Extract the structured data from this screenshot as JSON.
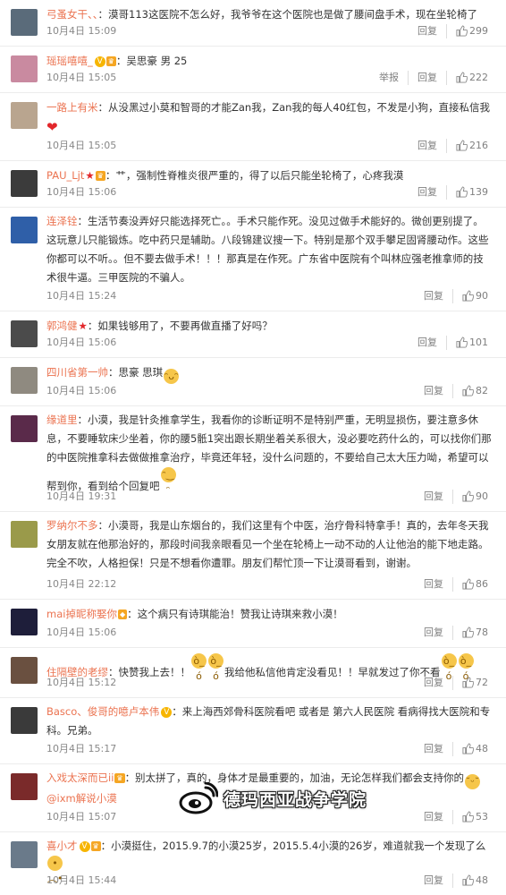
{
  "actions": {
    "report": "举报",
    "reply": "回复"
  },
  "comments": [
    {
      "user": "弓蚤女干、、",
      "text": "：漠哥113这医院不怎么好，我爷爷在这个医院也是做了腰间盘手术，现在坐轮椅了",
      "time": "10月4日 15:09",
      "likes": "299",
      "avatar_color": "#5a6b7a"
    },
    {
      "user": "瑶瑶嘻嘻_",
      "text": "：吴思豪 男 25",
      "time": "10月4日 15:05",
      "likes": "222",
      "avatar_color": "#c98aa0",
      "report": true
    },
    {
      "user": "一路上有米",
      "text": "：从没黑过小莫和智哥的才能Zan我，Zan我的每人40红包，不发是小狗，直接私信我",
      "time": "10月4日 15:05",
      "likes": "216",
      "avatar_color": "#b9a58f"
    },
    {
      "user": "PAU_Ljt",
      "text": "：艹，强制性脊椎炎很严重的，得了以后只能坐轮椅了，心疼我漠",
      "time": "10月4日 15:06",
      "likes": "139",
      "avatar_color": "#3b3b3b"
    },
    {
      "user": "连泽铨",
      "text": "：生活节奏没弄好只能选择死亡。。手术只能作死。没见过做手术能好的。微创更别提了。这玩意儿只能锻炼。吃中药只是辅助。八段锦建议搜一下。特别是那个双手攀足固肾腰动作。这些你都可以不听。。但不要去做手术！！！那真是在作死。广东省中医院有个叫林应强老推拿师的技术很牛逼。三甲医院的不骗人。",
      "time": "10月4日 15:24",
      "likes": "90",
      "avatar_color": "#2f5fa8"
    },
    {
      "user": "郭鸿健",
      "text": "：如果钱够用了，不要再做直播了好吗？",
      "time": "10月4日 15:06",
      "likes": "101",
      "avatar_color": "#4b4b4b"
    },
    {
      "user": "四川省第一帅",
      "text": "：思豪 思琪",
      "time": "10月4日 15:06",
      "likes": "82",
      "avatar_color": "#8f8a80"
    },
    {
      "user": "缘道里",
      "text": "：小漠，我是针灸推拿学生，我看你的诊断证明不是特别严重，无明显损伤，要注意多休息，不要睡软床少坐着，你的腰5骶1突出跟长期坐着关系很大，没必要吃药什么的，可以找你们那的中医院推拿科去做做推拿治疗，毕竟还年轻，没什么问题的，不要给自己太大压力呦，希望可以帮到你，看到给个回复吧",
      "time": "10月4日 19:31",
      "likes": "90",
      "avatar_color": "#5a2a4a"
    },
    {
      "user": "罗纳尔不多",
      "text": "：小漠哥，我是山东烟台的，我们这里有个中医，治疗骨科特拿手！真的，去年冬天我女朋友就在他那治好的，那段时间我亲眼看见一个坐在轮椅上一动不动的人让他治的能下地走路。完全不吹，人格担保！只是不想看你遭罪。朋友们帮忙顶一下让漠哥看到，谢谢。",
      "time": "10月4日 22:12",
      "likes": "86",
      "avatar_color": "#9a9a4a"
    },
    {
      "user": "mai掉昵称娶你",
      "text": "：这个病只有诗琪能治！赞我让诗琪来救小漠！",
      "time": "10月4日 15:06",
      "likes": "78",
      "avatar_color": "#1e1e3a"
    },
    {
      "user": "住隔壁的老缪",
      "text": "：快赞我上去！！",
      "text2": "我给他私信他肯定没看见！！早就发过了你不看",
      "time": "10月4日 15:12",
      "likes": "72",
      "avatar_color": "#6a5040"
    },
    {
      "user": "Basco、俊哥的噫卢本伟",
      "text": "：来上海西郊骨科医院看吧 或者是 第六人民医院 看病得找大医院和专科。兄弟。",
      "time": "10月4日 15:17",
      "likes": "48",
      "avatar_color": "#3a3a3a"
    },
    {
      "user": "入戏太深而已ii",
      "text": "：别太拼了，真的，身体才是最重要的，加油，无论怎样我们都会支持你的",
      "mention": "@ixm解说小漠",
      "time": "10月4日 15:07",
      "likes": "53",
      "avatar_color": "#7a2a2a"
    },
    {
      "user": "喜小才",
      "text": "：小漠挺住，2015.9.7的小漠25岁，2015.5.4小漠的26岁，难道就我一个发现了么",
      "time": "10月4日 15:44",
      "likes": "48",
      "avatar_color": "#6a7a8a"
    }
  ],
  "watermark": {
    "text": "德玛西亚战争学院",
    "icon": "weibo-logo-icon"
  }
}
